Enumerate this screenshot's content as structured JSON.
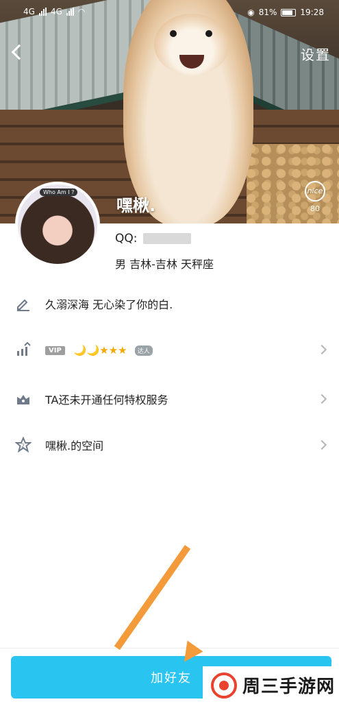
{
  "status_bar": {
    "time": "19:28",
    "battery": "81%",
    "network_left": "4G",
    "network_right": "4G"
  },
  "header": {
    "settings_label": "设置"
  },
  "profile": {
    "cover_nickname": "嘿楸.",
    "nice_label": "nice",
    "nice_count": "80",
    "avatar_tag": "Who Am I ?",
    "qq_label": "QQ:",
    "info": "男  吉林-吉林  天秤座"
  },
  "rows": {
    "signature": "久溺深海 无心染了你的白.",
    "vip_label": "VIP",
    "vip_icons": "🌙🌙★★★",
    "daren_label": "达人",
    "privilege": "TA还未开通任何特权服务",
    "space": "嘿楸.的空间"
  },
  "footer": {
    "add_friend": "加好友"
  },
  "watermark": {
    "text": "周三手游网"
  },
  "colors": {
    "accent": "#29c4f0",
    "annotation_arrow": "#f39b3b",
    "watermark_red": "#e9432f"
  }
}
